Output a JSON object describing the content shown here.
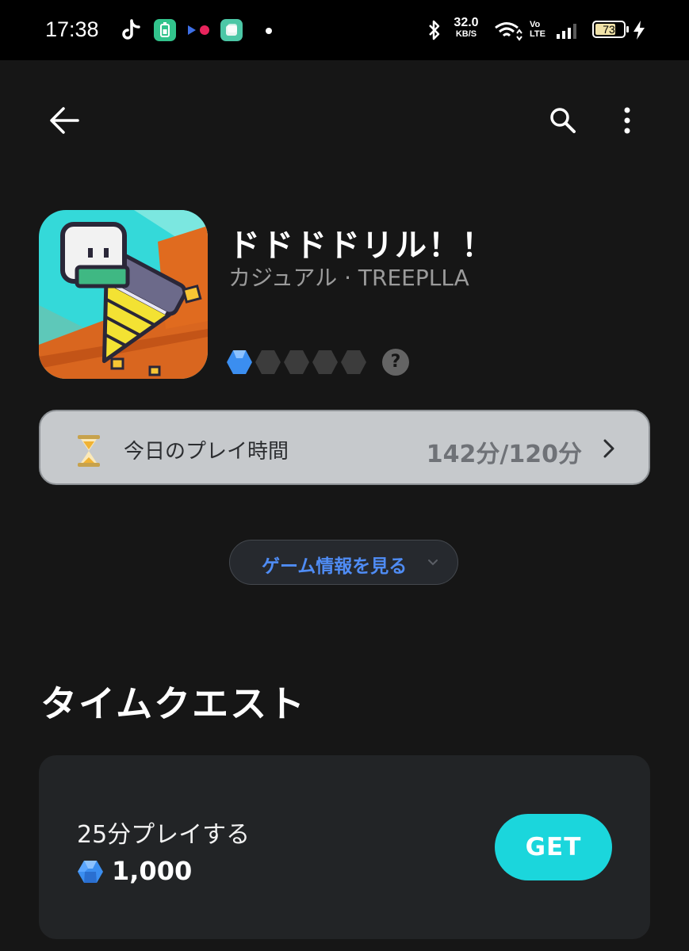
{
  "status_bar": {
    "time": "17:38",
    "speed_value": "32.0",
    "speed_unit": "KB/S",
    "volte_top": "Vo",
    "volte_bottom": "LTE",
    "battery_percent": "73",
    "battery_level": 0.73,
    "icons": [
      "tiktok-icon",
      "battery-app-icon",
      "flickr-icon",
      "app-icon",
      "notification-dot-icon",
      "bluetooth-icon",
      "wifi-icon",
      "signal-icon",
      "charging-icon"
    ]
  },
  "app_bar": {
    "icons": [
      "back-arrow-icon",
      "search-icon",
      "more-vert-icon"
    ]
  },
  "game": {
    "title": "ドドドドリル！！",
    "subtitle": "カジュアル · TREEPLLA",
    "rating_filled": 1,
    "rating_total": 5
  },
  "play_time": {
    "label": "今日のプレイ時間",
    "value": "142分",
    "separator": "/",
    "limit": "120分"
  },
  "info_button": {
    "label": "ゲーム情報を見る"
  },
  "time_quest": {
    "title": "タイムクエスト",
    "task": "25分プレイする",
    "reward": "1,000",
    "button": "GET"
  },
  "colors": {
    "background": "#161616",
    "accent_cyan": "#1bd6dc",
    "accent_blue": "#4f8cf4",
    "gem_blue": "#3b8ef0"
  }
}
